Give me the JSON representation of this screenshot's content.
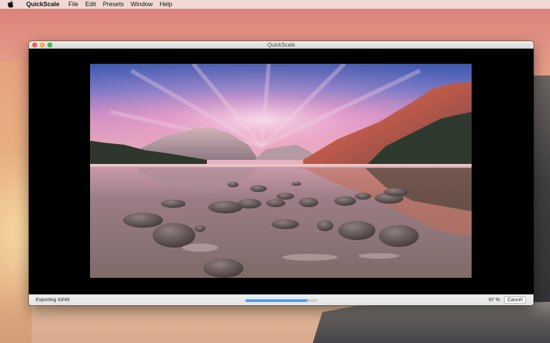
{
  "menubar": {
    "apple_icon": "apple-logo-icon",
    "app_name": "QuickScale",
    "items": [
      "File",
      "Edit",
      "Presets",
      "Window",
      "Help"
    ]
  },
  "window": {
    "title": "QuickScale",
    "traffic_lights": {
      "close_color": "#fc605b",
      "minimize_color": "#fdbc40",
      "maximize_color": "#34c84a"
    }
  },
  "preview": {
    "image_icon": "landscape-photo",
    "colors": {
      "sky_top": "#3d5fb5",
      "sky_pink": "#e48fb5",
      "cliff_glow": "#d9683c",
      "water": "#8a6a72"
    }
  },
  "status": {
    "text": "Exporting 43/49",
    "progress": 0.87,
    "percent_label": "87 %",
    "cancel_label": "Cancel",
    "accent": "#2f88ea"
  }
}
